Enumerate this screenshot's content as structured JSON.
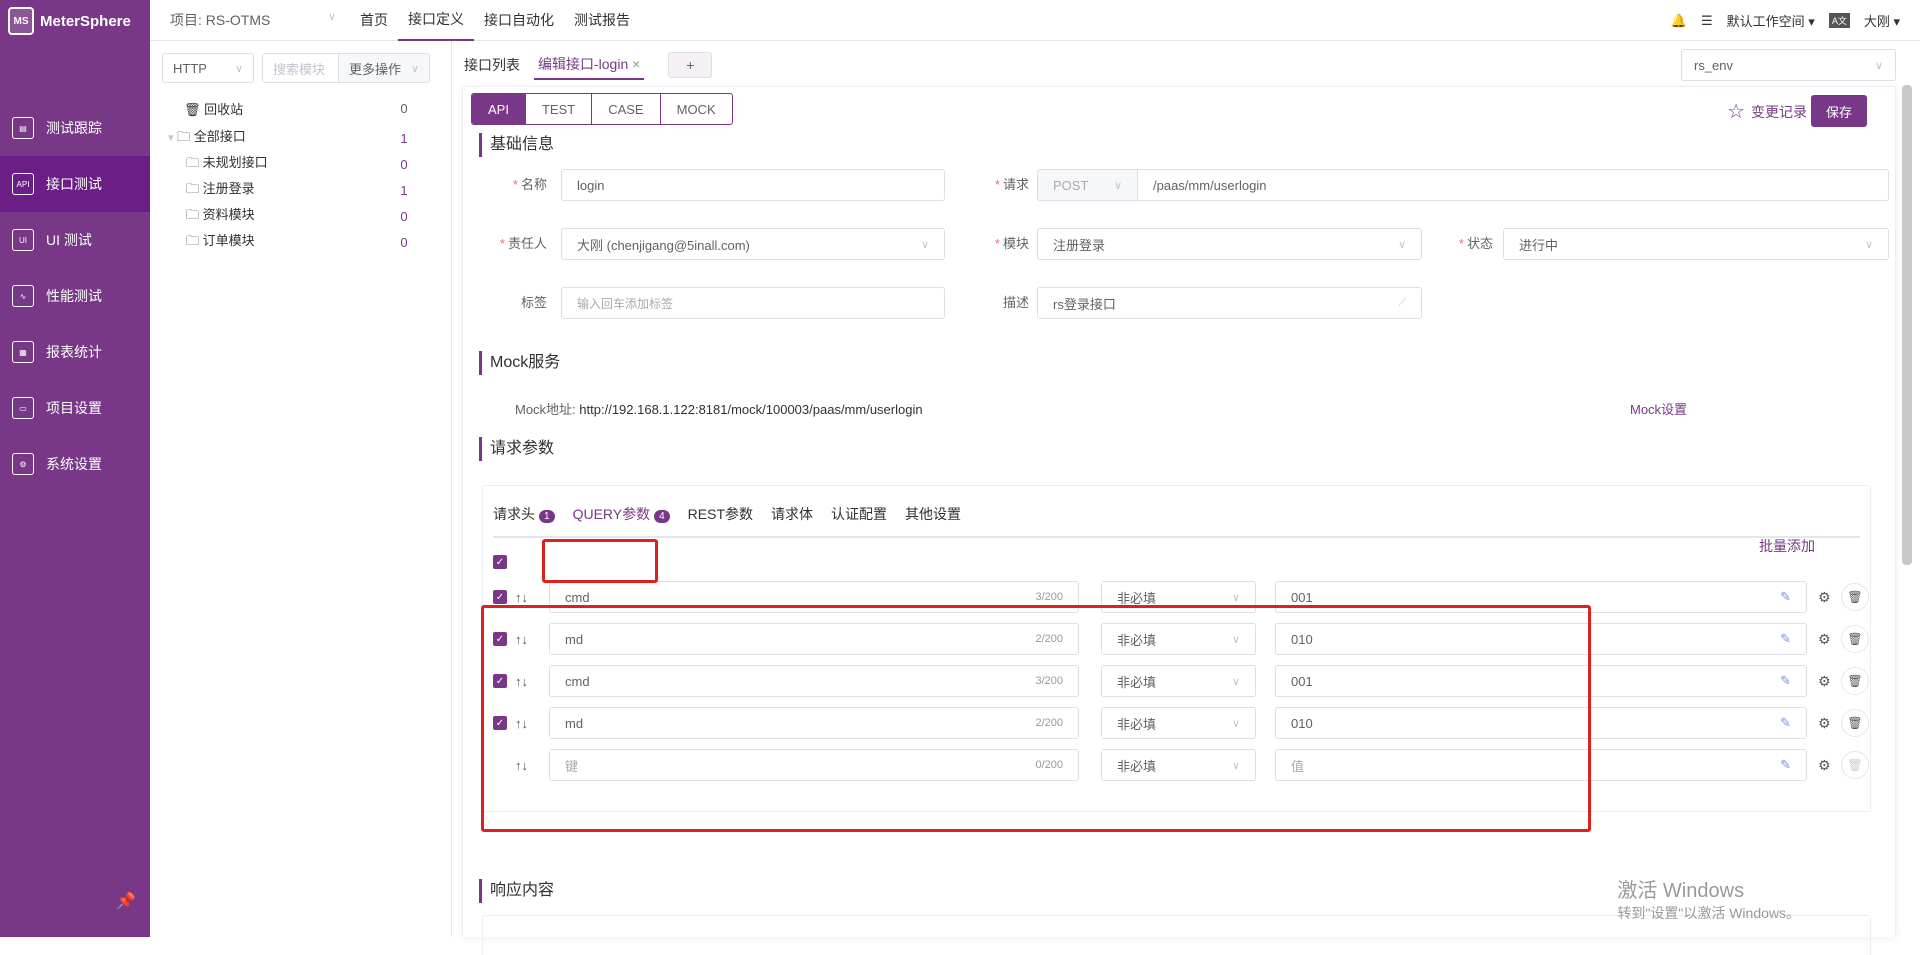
{
  "app": {
    "name": "MeterSphere",
    "logo_text": "MS"
  },
  "sidebar": {
    "items": [
      {
        "label": "测试跟踪",
        "icon": "clipboard-icon"
      },
      {
        "label": "接口测试",
        "icon": "api-icon",
        "active": true
      },
      {
        "label": "UI 测试",
        "icon": "ui-icon"
      },
      {
        "label": "性能测试",
        "icon": "performance-icon"
      },
      {
        "label": "报表统计",
        "icon": "report-icon"
      },
      {
        "label": "项目设置",
        "icon": "folder-settings-icon"
      },
      {
        "label": "系统设置",
        "icon": "gears-icon"
      }
    ],
    "pin_icon": "pin-icon"
  },
  "topbar": {
    "project": "项目: RS-OTMS",
    "nav": [
      "首页",
      "接口定义",
      "接口自动化",
      "测试报告"
    ],
    "active_nav": "接口定义",
    "workspace": "默认工作空间",
    "user": "大刚"
  },
  "tree": {
    "protocol": "HTTP",
    "search_placeholder": "搜索模块",
    "more": "更多操作",
    "recycle": {
      "label": "回收站",
      "count": "0"
    },
    "root": {
      "label": "全部接口",
      "count": "1"
    },
    "children": [
      {
        "label": "未规划接口",
        "count": "0"
      },
      {
        "label": "注册登录",
        "count": "1"
      },
      {
        "label": "资料模块",
        "count": "0"
      },
      {
        "label": "订单模块",
        "count": "0"
      }
    ]
  },
  "tabs": {
    "list": "接口列表",
    "edit": "编辑接口-login",
    "add": "+"
  },
  "env": "rs_env",
  "modes": [
    "API",
    "TEST",
    "CASE",
    "MOCK"
  ],
  "history": "变更记录",
  "save": "保存",
  "basic": {
    "title": "基础信息",
    "name_label": "名称",
    "name": "login",
    "req_label": "请求",
    "method": "POST",
    "path": "/paas/mm/userlogin",
    "owner_label": "责任人",
    "owner": "大刚 (chenjigang@5inall.com)",
    "module_label": "模块",
    "module": "注册登录",
    "status_label": "状态",
    "status": "进行中",
    "tag_label": "标签",
    "tag_placeholder": "输入回车添加标签",
    "desc_label": "描述",
    "desc": "rs登录接口"
  },
  "mock": {
    "title": "Mock服务",
    "addr_label": "Mock地址:",
    "addr": "http://192.168.1.122:8181/mock/100003/paas/mm/userlogin",
    "settings": "Mock设置"
  },
  "params": {
    "title": "请求参数",
    "tabs": [
      {
        "label": "请求头",
        "badge": "1"
      },
      {
        "label": "QUERY参数",
        "badge": "4"
      },
      {
        "label": "REST参数"
      },
      {
        "label": "请求体"
      },
      {
        "label": "认证配置"
      },
      {
        "label": "其他设置"
      }
    ],
    "batch": "批量添加",
    "rows": [
      {
        "checked": true,
        "key": "cmd",
        "count": "3/200",
        "required": "非必填",
        "value": "001"
      },
      {
        "checked": true,
        "key": "md",
        "count": "2/200",
        "required": "非必填",
        "value": "010"
      },
      {
        "checked": true,
        "key": "cmd",
        "count": "3/200",
        "required": "非必填",
        "value": "001"
      },
      {
        "checked": true,
        "key": "md",
        "count": "2/200",
        "required": "非必填",
        "value": "010"
      },
      {
        "checked": false,
        "key": "",
        "key_placeholder": "键",
        "count": "0/200",
        "required": "非必填",
        "value": "",
        "value_placeholder": "值"
      }
    ]
  },
  "response": {
    "title": "响应内容"
  },
  "watermark": {
    "line1": "激活 Windows",
    "line2": "转到\"设置\"以激活 Windows。"
  }
}
